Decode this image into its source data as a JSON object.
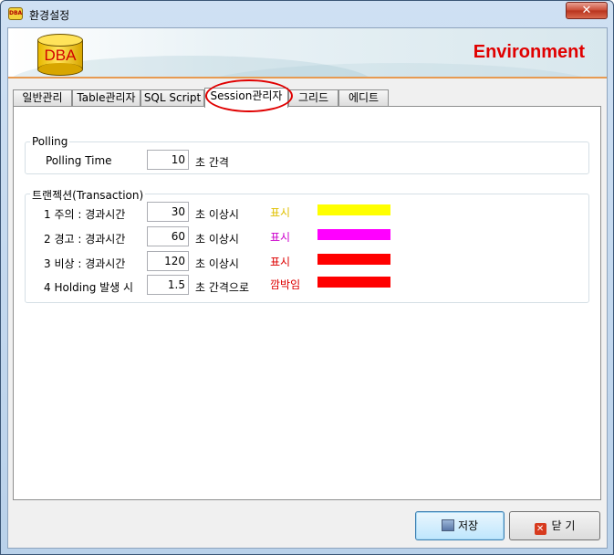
{
  "window": {
    "title": "환경설정",
    "app_icon": "DBA",
    "close_glyph": "✕"
  },
  "banner": {
    "logo_text": "DBA",
    "heading": "Environment"
  },
  "tabs": [
    {
      "label": "일반관리",
      "active": false
    },
    {
      "label": "Table관리자",
      "active": false
    },
    {
      "label": "SQL Script",
      "active": false
    },
    {
      "label": "Session관리자",
      "active": true
    },
    {
      "label": "그리드",
      "active": false
    },
    {
      "label": "에디트",
      "active": false
    }
  ],
  "polling": {
    "group_title": "Polling",
    "label": "Polling Time",
    "value": "10",
    "unit": "초 간격"
  },
  "transaction": {
    "group_title": "트랜젝션(Transaction)",
    "rows": [
      {
        "label": "1 주의 :  경과시간",
        "value": "30",
        "unit": "초 이상시",
        "status": "표시",
        "status_color": "#e0c000",
        "swatch_color": "#ffff00"
      },
      {
        "label": "2 경고 :  경과시간",
        "value": "60",
        "unit": "초 이상시",
        "status": "표시",
        "status_color": "#cc00cc",
        "swatch_color": "#ff00ff"
      },
      {
        "label": "3 비상 :  경과시간",
        "value": "120",
        "unit": "초 이상시",
        "status": "표시",
        "status_color": "#dd0000",
        "swatch_color": "#ff0000"
      },
      {
        "label": "4 Holding 발생 시",
        "value": "1.5",
        "unit": "초 간격으로",
        "status": "깜박임",
        "status_color": "#dd0000",
        "swatch_color": "#ff0000"
      }
    ]
  },
  "buttons": {
    "save": "저장",
    "close": "닫 기"
  }
}
